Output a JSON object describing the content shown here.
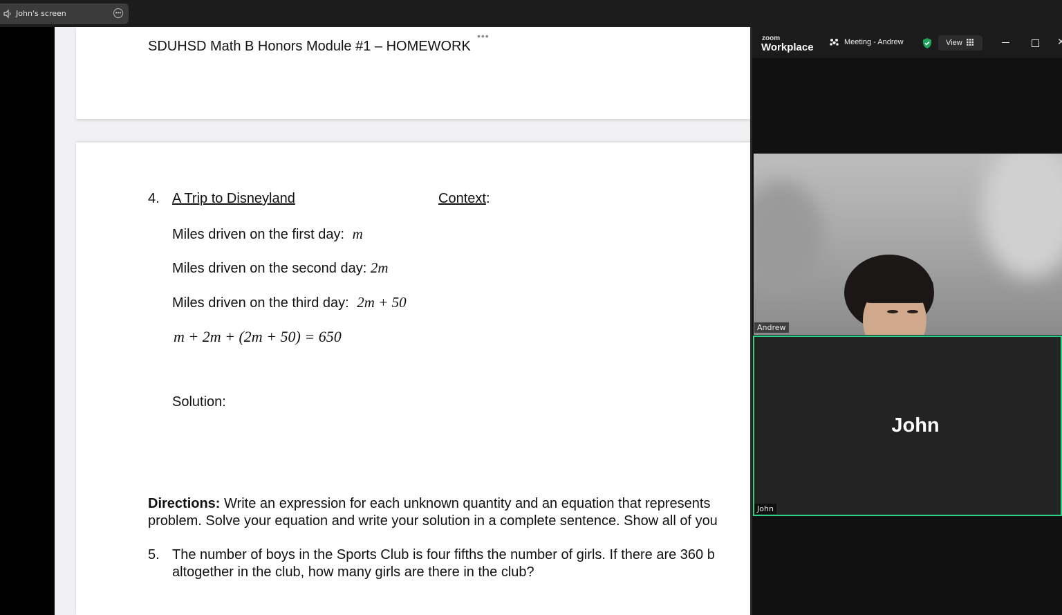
{
  "share_bar": {
    "label": "John's screen"
  },
  "document": {
    "header_title": "SDUHSD Math B Honors Module #1 – HOMEWORK",
    "problem4": {
      "number": "4.",
      "title": "A Trip to Disneyland",
      "context_label": "Context",
      "context_colon": ":",
      "line1_text": "Miles driven on the first day:",
      "line1_math": "m",
      "line2_text": "Miles driven on the second day:",
      "line2_math": "2m",
      "line3_text": "Miles driven on the third day:",
      "line3_math": "2m + 50",
      "equation": "m + 2m + (2m + 50) = 650",
      "solution_label": "Solution:"
    },
    "directions": {
      "label": "Directions:",
      "line1": "Write an expression for each unknown quantity and an equation that represents",
      "line2": "problem. Solve your equation and write your solution in a complete sentence. Show all of you"
    },
    "problem5": {
      "number": "5.",
      "line1": "The number of boys in the Sports Club is four fifths the number of girls.  If there are 360 b",
      "line2": "altogether in the club, how many girls are there in the club?"
    }
  },
  "zoom": {
    "brand_small": "zoom",
    "brand_big": "Workplace",
    "meeting_title": "Meeting - Andrew",
    "view_label": "View",
    "participants": [
      {
        "name": "Andrew"
      },
      {
        "name": "John",
        "display": "John"
      }
    ],
    "colors": {
      "active_speaker": "#2fd08a",
      "shield": "#1fa25a"
    }
  }
}
